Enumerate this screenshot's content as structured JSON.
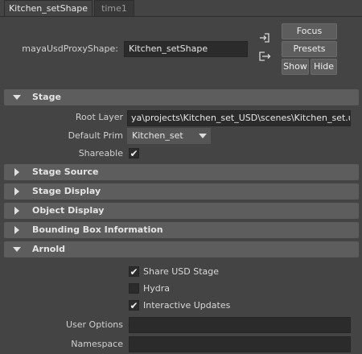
{
  "tabs": [
    {
      "label": "Kitchen_setShape",
      "active": true
    },
    {
      "label": "time1",
      "active": false
    }
  ],
  "header": {
    "node_type_label": "mayaUsdProxyShape:",
    "node_name": "Kitchen_setShape",
    "buttons": {
      "focus": "Focus",
      "presets": "Presets",
      "show": "Show",
      "hide": "Hide"
    }
  },
  "sections": {
    "stage": "Stage",
    "stage_source": "Stage Source",
    "stage_display": "Stage Display",
    "object_display": "Object Display",
    "bounding_box": "Bounding Box Information",
    "arnold": "Arnold"
  },
  "stage": {
    "root_layer_label": "Root Layer",
    "root_layer_value": "ya\\projects\\Kitchen_set_USD\\scenes\\Kitchen_set.usd",
    "default_prim_label": "Default Prim",
    "default_prim_value": "Kitchen_set",
    "shareable_label": "Shareable",
    "shareable_checked": true
  },
  "arnold": {
    "share_usd_stage": {
      "label": "Share USD Stage",
      "checked": true
    },
    "hydra": {
      "label": "Hydra",
      "checked": false
    },
    "interactive_updates": {
      "label": "Interactive Updates",
      "checked": true
    },
    "user_options_label": "User Options",
    "user_options_value": "",
    "namespace_label": "Namespace",
    "namespace_value": ""
  },
  "icons": {
    "checkmark": "✔",
    "input_connection": "input-connection-icon",
    "output_connection": "output-connection-icon"
  },
  "colors": {
    "background": "#444444",
    "section_header": "#5d5d5d",
    "field": "#2b2b2b"
  }
}
